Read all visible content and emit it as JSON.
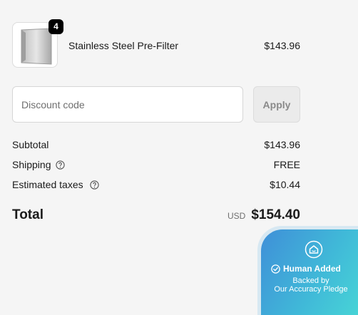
{
  "cart": {
    "item": {
      "name": "Stainless Steel Pre-Filter",
      "price": "$143.96",
      "quantity": "4",
      "image_icon": "steel-filter-panel"
    }
  },
  "discount": {
    "placeholder": "Discount code",
    "value": "",
    "apply_label": "Apply"
  },
  "totals": {
    "subtotal_label": "Subtotal",
    "subtotal_value": "$143.96",
    "shipping_label": "Shipping",
    "shipping_value": "FREE",
    "taxes_label": "Estimated taxes",
    "taxes_value": "$10.44",
    "total_label": "Total",
    "currency": "USD",
    "total_value": "$154.40"
  },
  "trust_badge": {
    "title": "Human Added",
    "line1": "Backed by",
    "line2": "Our Accuracy Pledge",
    "icon": "home-shield-icon"
  },
  "colors": {
    "background": "#f5f5f5",
    "badge_gradient_start": "#3f8fd8",
    "badge_gradient_end": "#48d6d6",
    "qty_badge": "#000000"
  }
}
